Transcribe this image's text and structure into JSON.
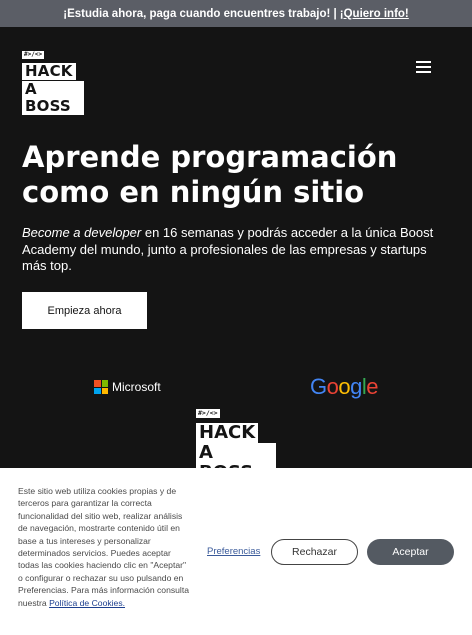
{
  "banner": {
    "text": "¡Estudia ahora, paga cuando encuentres trabajo! |",
    "link": "¡Quiero info!"
  },
  "header": {
    "logo": {
      "code": "#>/<>",
      "line1": "HACK",
      "line2": "A BOSS"
    },
    "menu_icon": "hamburger-menu-icon"
  },
  "hero": {
    "title_line1": "Aprende programación",
    "title_line2": "como en ningún sitio",
    "subtitle_em": "Become a developer",
    "subtitle_rest": " en 16 semanas y podrás acceder a la única Boost Academy del mundo, junto a profesionales de las empresas y startups más top.",
    "cta_label": "Empieza ahora"
  },
  "partners": {
    "microsoft": {
      "name": "Microsoft",
      "colors": [
        "#f25022",
        "#7fba00",
        "#00a4ef",
        "#ffb900"
      ]
    },
    "google": {
      "letters": [
        "G",
        "o",
        "o",
        "g",
        "l",
        "e"
      ],
      "colors": [
        "#4285f4",
        "#ea4335",
        "#fbbc05",
        "#4285f4",
        "#34a853",
        "#ea4335"
      ]
    }
  },
  "logo_secondary": {
    "code": "#>/<>",
    "line1": "HACK",
    "line2": "A BOSS"
  },
  "cookies": {
    "text": "Este sitio web utiliza cookies propias y de terceros para garantizar la correcta funcionalidad del sitio web, realizar análisis de navegación, mostrarte contenido útil en base a tus intereses y personalizar determinados servicios. Puedes aceptar todas las cookies haciendo clic en \"Aceptar\" o configurar o rechazar su uso pulsando en Preferencias. Para más información consulta nuestra ",
    "policy_link": "Política de Cookies.",
    "preferences_label": "Preferencias",
    "reject_label": "Rechazar",
    "accept_label": "Aceptar"
  }
}
